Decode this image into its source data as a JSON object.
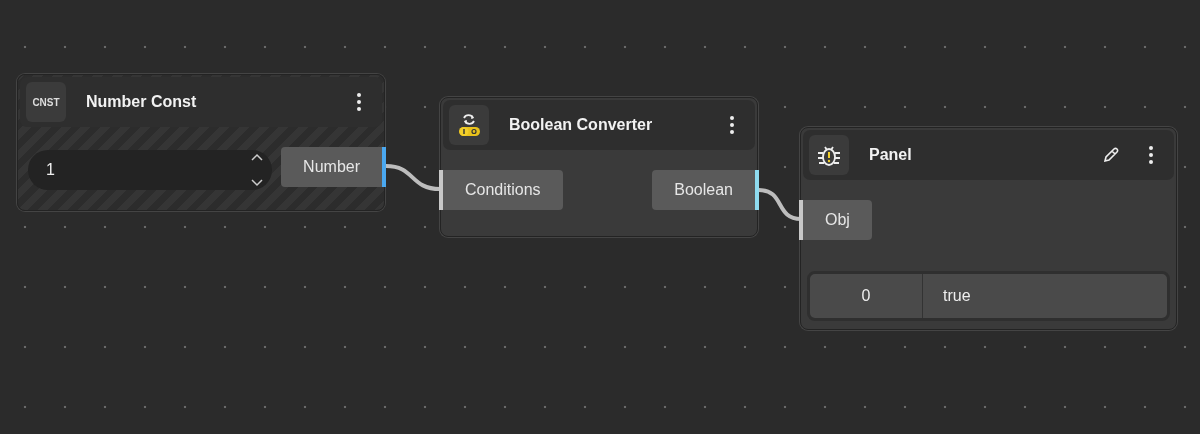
{
  "nodes": [
    {
      "kind": "const",
      "badge": "CNST",
      "title": "Number Const",
      "field": {
        "value": "1"
      },
      "outputs": [
        {
          "label": "Number",
          "color": "#4aa8f0"
        }
      ]
    },
    {
      "kind": "converter",
      "title": "Boolean Converter",
      "inputs": [
        {
          "label": "Conditions"
        }
      ],
      "outputs": [
        {
          "label": "Boolean",
          "color": "#8fdcf0"
        }
      ]
    },
    {
      "kind": "panel",
      "title": "Panel",
      "inputs": [
        {
          "label": "Obj"
        }
      ],
      "rows": [
        {
          "index": "0",
          "value": "true"
        }
      ]
    }
  ]
}
